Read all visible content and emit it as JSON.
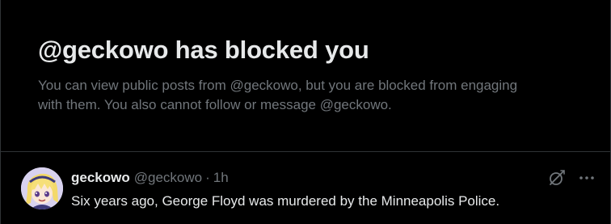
{
  "block_notice": {
    "title": "@geckowo has blocked you",
    "description": "You can view public posts from @geckowo, but you are blocked from engaging with them. You also cannot follow or message @geckowo."
  },
  "post": {
    "display_name": "geckowo",
    "handle": "@geckowo",
    "separator": "·",
    "timestamp": "1h",
    "text": "Six years ago, George Floyd was murdered by the Minneapolis Police."
  },
  "icons": {
    "avatar": "anime-avatar",
    "grok": "grok-icon",
    "more": "more-horizontal-icon"
  },
  "colors": {
    "background": "#000000",
    "primary_text": "#e7e9ea",
    "secondary_text": "#71767b",
    "border": "#2f3336"
  }
}
